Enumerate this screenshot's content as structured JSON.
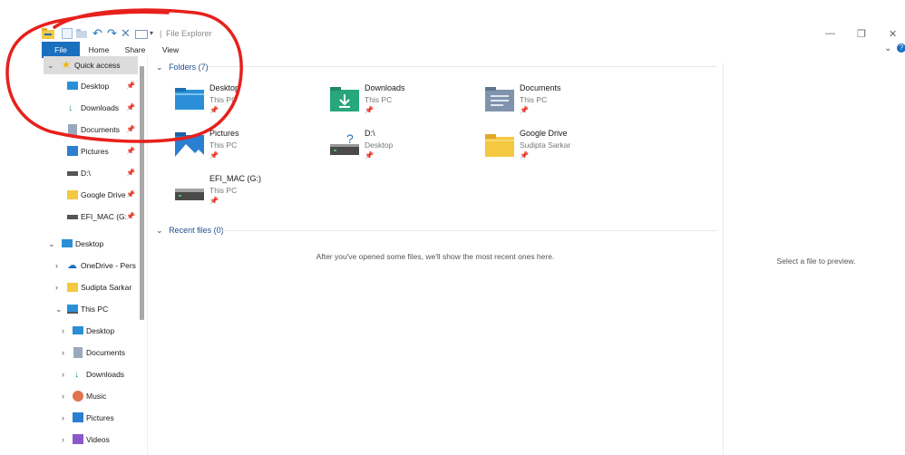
{
  "window": {
    "title": "File Explorer",
    "separator": "|",
    "minimize_glyph": "—",
    "restore_glyph": "❐",
    "close_glyph": "✕",
    "help_glyph": "?",
    "ribbon_toggle_glyph": "⌄"
  },
  "ribbon": {
    "tabs": [
      {
        "label": "File"
      },
      {
        "label": "Home"
      },
      {
        "label": "Share"
      },
      {
        "label": "View"
      }
    ]
  },
  "nav": {
    "quick_access": {
      "label": "Quick access",
      "items": [
        {
          "label": "Desktop",
          "icon": "desktop-folder-icon",
          "pinned": true
        },
        {
          "label": "Downloads",
          "icon": "downloads-icon",
          "pinned": true
        },
        {
          "label": "Documents",
          "icon": "documents-icon",
          "pinned": true
        },
        {
          "label": "Pictures",
          "icon": "pictures-icon",
          "pinned": true
        },
        {
          "label": "D:\\",
          "icon": "drive-icon",
          "pinned": true
        },
        {
          "label": "Google Drive",
          "icon": "folder-icon",
          "pinned": true
        },
        {
          "label": "EFI_MAC (G:)",
          "icon": "drive-icon",
          "pinned": true
        }
      ]
    },
    "desktop": {
      "label": "Desktop",
      "children": [
        {
          "label": "OneDrive - Pers"
        },
        {
          "label": "Sudipta Sarkar"
        }
      ]
    },
    "this_pc": {
      "label": "This PC",
      "children": [
        {
          "label": "Desktop"
        },
        {
          "label": "Documents"
        },
        {
          "label": "Downloads"
        },
        {
          "label": "Music"
        },
        {
          "label": "Pictures"
        },
        {
          "label": "Videos"
        }
      ]
    },
    "pin_glyph": "📌"
  },
  "main": {
    "folders_header": "Folders (7)",
    "recent_header": "Recent files (0)",
    "empty_message": "After you've opened some files, we'll show the most recent ones here.",
    "folders": [
      {
        "name": "Desktop",
        "location": "This PC",
        "icon": "desktop-folder-icon"
      },
      {
        "name": "Downloads",
        "location": "This PC",
        "icon": "downloads-folder-icon"
      },
      {
        "name": "Documents",
        "location": "This PC",
        "icon": "documents-folder-icon"
      },
      {
        "name": "Pictures",
        "location": "This PC",
        "icon": "pictures-folder-icon"
      },
      {
        "name": "D:\\",
        "location": "Desktop",
        "icon": "drive-question-icon"
      },
      {
        "name": "Google Drive",
        "location": "Sudipta Sarkar",
        "icon": "folder-icon"
      },
      {
        "name": "EFI_MAC (G:)",
        "location": "This PC",
        "icon": "drive-icon"
      }
    ]
  },
  "preview": {
    "message": "Select a file to preview."
  },
  "colors": {
    "accent": "#1a6fbf",
    "annotation": "#e8201c",
    "folder_yellow": "#f5c842",
    "folder_blue": "#2a8fd6",
    "folder_teal": "#27a77b"
  }
}
